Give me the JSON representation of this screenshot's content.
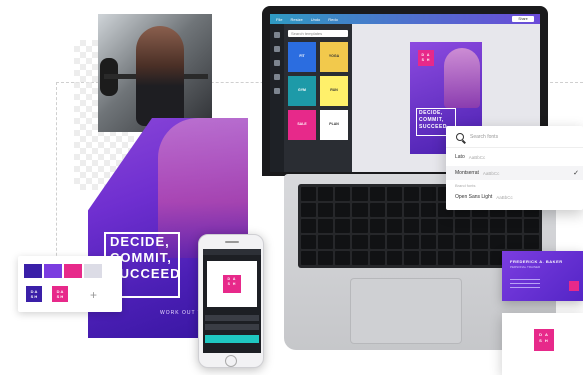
{
  "colors": {
    "brand_purple": "#6f2fd0",
    "brand_pink": "#e7298a",
    "teal": "#1fc7c1"
  },
  "poster": {
    "headline": "DECIDE,\nCOMMIT,\nSUCCEED",
    "footer": "WORK OUT WITH US"
  },
  "editor": {
    "topbar_items": [
      "File",
      "Resize",
      "Undo",
      "Redo"
    ],
    "share_label": "Share",
    "template_search_placeholder": "Search templates",
    "templates": [
      {
        "label": "FIT",
        "color": "#2b6de0"
      },
      {
        "label": "YOGA",
        "color": "#f2c94c"
      },
      {
        "label": "GYM",
        "color": "#1d9aa8"
      },
      {
        "label": "RUN",
        "color": "#fff06a"
      },
      {
        "label": "SALE",
        "color": "#e7298a"
      },
      {
        "label": "PLAN",
        "color": "#ffffff"
      }
    ],
    "design_logo": "D A\nS H",
    "design_headline": "DECIDE,\nCOMMIT,\nSUCCEED"
  },
  "font_dropdown": {
    "search_placeholder": "Search fonts",
    "fonts": [
      {
        "name": "Lato",
        "sample": "AaBbCc",
        "selected": false
      },
      {
        "name": "Montserrat",
        "sample": "AaBbCc",
        "selected": true
      },
      {
        "name": "Open Sans Light",
        "sample": "AaBbCc",
        "selected": false
      }
    ],
    "section_label": "Brand fonts"
  },
  "swatches": {
    "colors": [
      "#3a1fa8",
      "#7b3de0",
      "#e7298a",
      "#dcdce6"
    ],
    "tiles": [
      {
        "label": "D A\nS H",
        "color": "#3a1fa8"
      },
      {
        "label": "D A\nS H",
        "color": "#e7298a"
      }
    ],
    "add_label": "+"
  },
  "phone": {
    "logo": "D A\nS H"
  },
  "business_card": {
    "name": "FREDERICK A. BAKER",
    "title": "PERSONAL TRAINER",
    "back_logo": "D A\nS H"
  }
}
